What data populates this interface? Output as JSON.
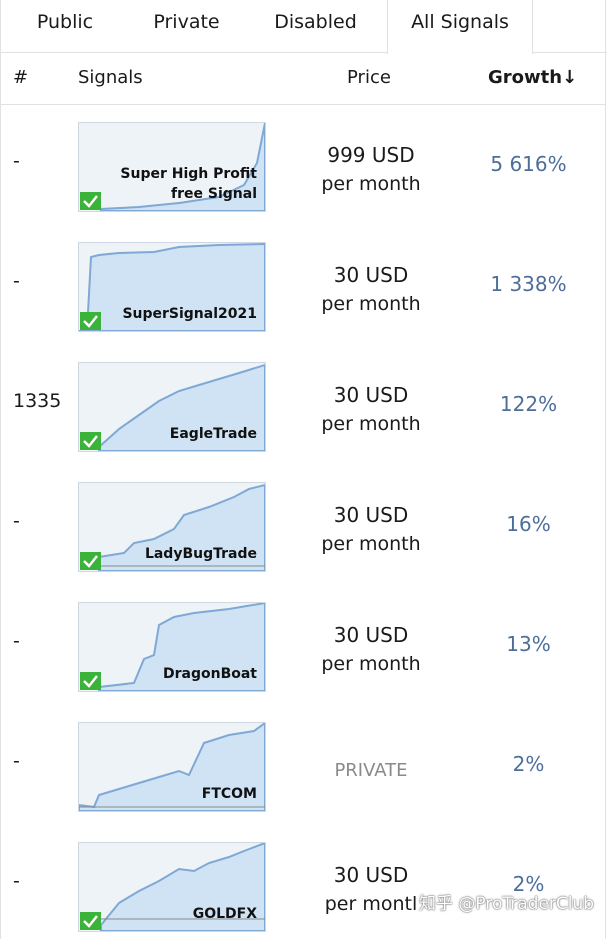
{
  "tabs": [
    "Public",
    "Private",
    "Disabled",
    "All Signals"
  ],
  "header": {
    "rank": "#",
    "signals": "Signals",
    "price": "Price",
    "growth": "Growth↓"
  },
  "rows": [
    {
      "rank": "-",
      "name_line1": "Super High Profit",
      "name_line2": "free Signal",
      "price_amount": "999 USD",
      "price_period": "per month",
      "growth": "5 616%"
    },
    {
      "rank": "-",
      "name_line1": "",
      "name_line2": "SuperSignal2021",
      "price_amount": "30 USD",
      "price_period": "per month",
      "growth": "1 338%"
    },
    {
      "rank": "1335",
      "name_line1": "",
      "name_line2": "EagleTrade",
      "price_amount": "30 USD",
      "price_period": "per month",
      "growth": "122%"
    },
    {
      "rank": "-",
      "name_line1": "",
      "name_line2": "LadyBugTrade",
      "price_amount": "30 USD",
      "price_period": "per month",
      "growth": "16%"
    },
    {
      "rank": "-",
      "name_line1": "",
      "name_line2": "DragonBoat",
      "price_amount": "30 USD",
      "price_period": "per month",
      "growth": "13%"
    },
    {
      "rank": "-",
      "name_line1": "",
      "name_line2": "FTCOM",
      "price_private": "PRIVATE",
      "growth": "2%"
    },
    {
      "rank": "-",
      "name_line1": "",
      "name_line2": "GOLDFX",
      "price_amount": "30 USD",
      "price_period": "per montl",
      "growth": "2%"
    }
  ],
  "watermark": "知乎 @ProTraderClub",
  "colors": {
    "growth": "#4d6e9b",
    "chart_fill": "#cfe3f5",
    "chart_line": "#7fa8d4",
    "check": "#3bb33b",
    "private": "#8a8a8a"
  },
  "icons": {
    "check": "check-badge-icon",
    "sort": "sort-down-arrow-icon"
  }
}
